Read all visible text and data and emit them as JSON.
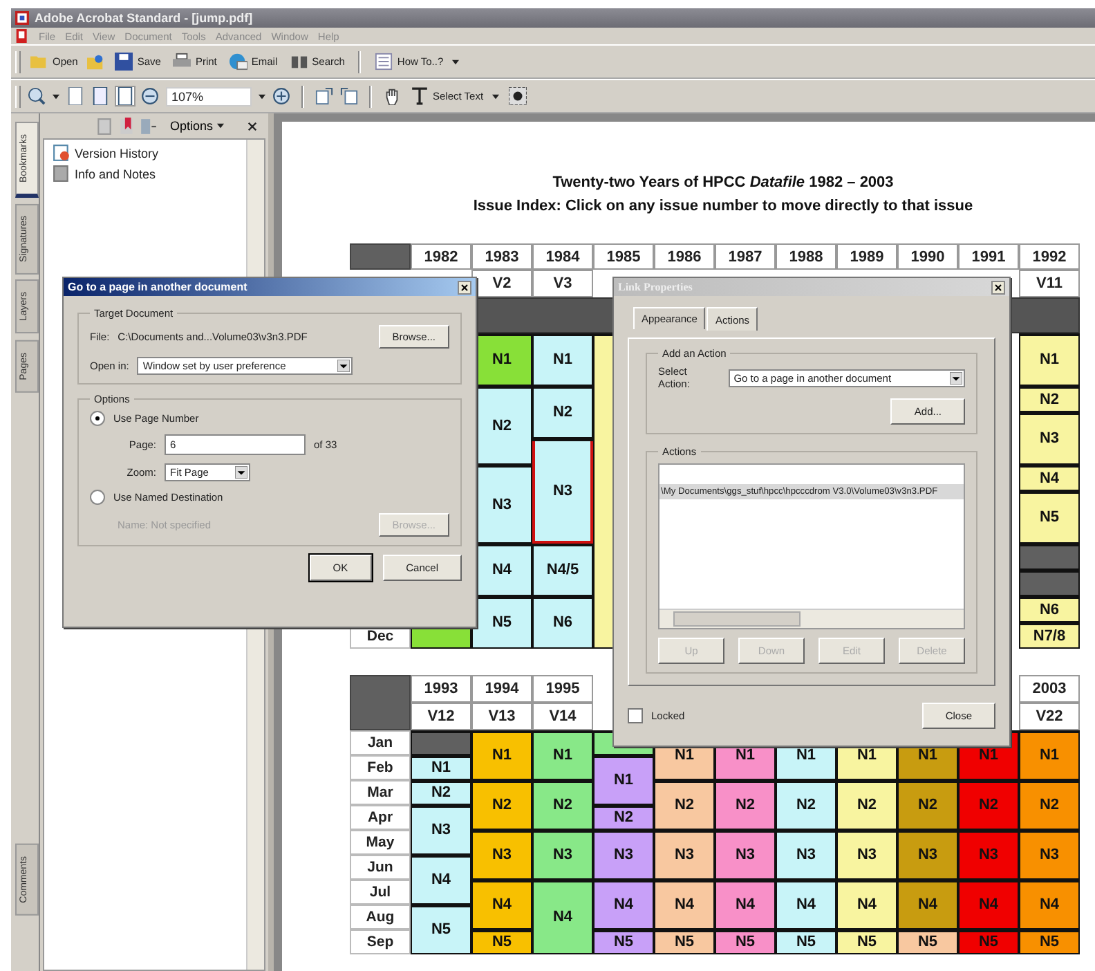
{
  "window": {
    "title": "Adobe Acrobat Standard - [jump.pdf]"
  },
  "menu": [
    "File",
    "Edit",
    "View",
    "Document",
    "Tools",
    "Advanced",
    "Window",
    "Help"
  ],
  "toolbar": {
    "open": "Open",
    "save": "Save",
    "print": "Print",
    "email": "Email",
    "search": "Search",
    "how_to": "How To..?",
    "zoom": "107%",
    "select_text": "Select Text"
  },
  "side_tabs": [
    {
      "label": "Bookmarks",
      "selected": true
    },
    {
      "label": "Signatures",
      "selected": false
    },
    {
      "label": "Layers",
      "selected": false
    },
    {
      "label": "Pages",
      "selected": false
    }
  ],
  "comments_tab": {
    "label": "Comments",
    "selected": false
  },
  "bookmarks_panel": {
    "options": "Options",
    "items": [
      {
        "label": "Version History",
        "kind": "history"
      },
      {
        "label": "Info and Notes",
        "kind": "page"
      }
    ]
  },
  "document": {
    "title": "Twenty-two Years of HPCC *Datafile* 1982 – 2003",
    "subtitle": "Issue Index: Click on any issue number to move directly to that issue",
    "upper_table": {
      "last_row_label": "Dec",
      "columns": [
        {
          "year": "1982",
          "last_cell": {
            "color": "#88e038",
            "selected": false
          }
        },
        {
          "year": "1983",
          "volume": "V2",
          "cells": [
            {
              "text": "N1",
              "color": "#88e038",
              "selected": false
            },
            {
              "merged": true
            },
            {
              "text": "N2",
              "color": "#c8f4f8",
              "selected": false
            },
            {
              "merged": true
            },
            {
              "merged": true
            },
            {
              "text": "N3",
              "color": "#c8f4f8",
              "selected": false
            },
            {
              "merged": true
            },
            {
              "merged": true
            },
            {
              "text": "N4",
              "color": "#c8f4f8",
              "selected": false
            },
            {
              "merged": true
            },
            {
              "text": "N5",
              "color": "#c8f4f8",
              "selected": false
            },
            {
              "merged": true
            }
          ]
        },
        {
          "year": "1984",
          "volume": "V3",
          "cells": [
            {
              "text": "N1",
              "color": "#c8f4f8",
              "selected": false
            },
            {
              "merged": true
            },
            {
              "text": "N2",
              "color": "#c8f4f8",
              "selected": false
            },
            {
              "merged": true
            },
            {
              "text": "N3",
              "color": "#c8f4f8",
              "selected": true
            },
            {
              "merged": true
            },
            {
              "merged": true
            },
            {
              "merged": true
            },
            {
              "text": "N4/5",
              "color": "#c8f4f8",
              "selected": false
            },
            {
              "merged": true
            },
            {
              "text": "N6",
              "color": "#c8f4f8",
              "selected": false
            },
            {
              "merged": true
            }
          ]
        },
        {
          "year": "1985",
          "cells": [
            {
              "color": "#f8f4a0",
              "selected": false
            },
            {
              "merged": true
            },
            {
              "merged": true
            },
            {
              "merged": true
            },
            {
              "merged": true
            },
            {
              "merged": true
            },
            {
              "merged": true
            },
            {
              "merged": true
            },
            {
              "merged": true
            },
            {
              "merged": true
            },
            {
              "merged": true
            },
            {
              "merged": true
            }
          ]
        },
        {
          "year": "1986"
        },
        {
          "year": "1987"
        },
        {
          "year": "1988"
        },
        {
          "year": "1989"
        },
        {
          "year": "1990"
        },
        {
          "year": "1991"
        },
        {
          "year": "1992",
          "volume": "V11",
          "cells": [
            {
              "text": "N1",
              "color": "#f8f4a0",
              "selected": false
            },
            {
              "merged": true
            },
            {
              "text": "N2",
              "color": "#f8f4a0",
              "selected": false
            },
            {
              "text": "N3",
              "color": "#f8f4a0",
              "selected": false
            },
            {
              "merged": true
            },
            {
              "text": "N4",
              "color": "#f8f4a0",
              "selected": false
            },
            {
              "text": "N5",
              "color": "#f8f4a0",
              "selected": false
            },
            {
              "merged": true
            },
            {
              "color": "#606060",
              "selected": false
            },
            {
              "color": "#606060",
              "selected": false
            },
            {
              "text": "N6",
              "color": "#f8f4a0",
              "selected": false
            },
            {
              "text": "N7/8",
              "color": "#f8f4a0",
              "selected": false
            }
          ]
        }
      ]
    },
    "lower_table": {
      "month_labels": [
        "Jan",
        "Feb",
        "Mar",
        "Apr",
        "May",
        "Jun",
        "Jul",
        "Aug",
        "Sep"
      ],
      "columns": [
        {
          "year": "1993",
          "volume": "V12",
          "cells": [
            {
              "color": "#606060",
              "selected": false
            },
            {
              "text": "N1",
              "color": "#c8f4f8",
              "selected": false
            },
            {
              "text": "N2",
              "color": "#c8f4f8",
              "selected": false
            },
            {
              "text": "N3",
              "color": "#c8f4f8",
              "selected": false
            },
            {
              "merged": true
            },
            {
              "text": "N4",
              "color": "#c8f4f8",
              "selected": false
            },
            {
              "merged": true
            },
            {
              "text": "N5",
              "color": "#c8f4f8",
              "selected": false
            },
            {
              "merged": true
            }
          ]
        },
        {
          "year": "1994",
          "volume": "V13",
          "cells": [
            {
              "text": "N1",
              "color": "#f8c000",
              "selected": false
            },
            {
              "merged": true
            },
            {
              "text": "N2",
              "color": "#f8c000",
              "selected": false
            },
            {
              "merged": true
            },
            {
              "text": "N3",
              "color": "#f8c000",
              "selected": false
            },
            {
              "merged": true
            },
            {
              "text": "N4",
              "color": "#f8c000",
              "selected": false
            },
            {
              "merged": true
            },
            {
              "text": "N5",
              "color": "#f8c000",
              "selected": false
            }
          ]
        },
        {
          "year": "1995",
          "volume": "V14",
          "cells": [
            {
              "text": "N1",
              "color": "#88e888",
              "selected": false
            },
            {
              "merged": true
            },
            {
              "text": "N2",
              "color": "#88e888",
              "selected": false
            },
            {
              "merged": true
            },
            {
              "text": "N3",
              "color": "#88e888",
              "selected": false
            },
            {
              "merged": true
            },
            {
              "text": "N4",
              "color": "#88e888",
              "selected": false
            },
            {
              "merged": true
            },
            {
              "merged": true
            }
          ]
        },
        {
          "cells": [
            {
              "color": "#88e888",
              "selected": false
            },
            {
              "text": "N1",
              "color": "#c8a0f8",
              "selected": false
            },
            {
              "merged": true
            },
            {
              "text": "N2",
              "color": "#c8a0f8",
              "selected": false
            },
            {
              "text": "N3",
              "color": "#c8a0f8",
              "selected": false
            },
            {
              "merged": true
            },
            {
              "text": "N4",
              "color": "#c8a0f8",
              "selected": false
            },
            {
              "merged": true
            },
            {
              "text": "N5",
              "color": "#c8a0f8",
              "selected": false
            }
          ]
        },
        {
          "cells": [
            {
              "text": "N1",
              "color": "#f8c8a0",
              "selected": false
            },
            {
              "merged": true
            },
            {
              "text": "N2",
              "color": "#f8c8a0",
              "selected": false
            },
            {
              "merged": true
            },
            {
              "text": "N3",
              "color": "#f8c8a0",
              "selected": false
            },
            {
              "merged": true
            },
            {
              "text": "N4",
              "color": "#f8c8a0",
              "selected": false
            },
            {
              "merged": true
            },
            {
              "text": "N5",
              "color": "#f8c8a0",
              "selected": false
            }
          ]
        },
        {
          "cells": [
            {
              "text": "N1",
              "color": "#f890c8",
              "selected": false
            },
            {
              "merged": true
            },
            {
              "text": "N2",
              "color": "#f890c8",
              "selected": false
            },
            {
              "merged": true
            },
            {
              "text": "N3",
              "color": "#f890c8",
              "selected": false
            },
            {
              "merged": true
            },
            {
              "text": "N4",
              "color": "#f890c8",
              "selected": false
            },
            {
              "merged": true
            },
            {
              "text": "N5",
              "color": "#f890c8",
              "selected": false
            }
          ]
        },
        {
          "cells": [
            {
              "text": "N1",
              "color": "#c8f4f8",
              "selected": false
            },
            {
              "merged": true
            },
            {
              "text": "N2",
              "color": "#c8f4f8",
              "selected": false
            },
            {
              "merged": true
            },
            {
              "text": "N3",
              "color": "#c8f4f8",
              "selected": false
            },
            {
              "merged": true
            },
            {
              "text": "N4",
              "color": "#c8f4f8",
              "selected": false
            },
            {
              "merged": true
            },
            {
              "text": "N5",
              "color": "#c8f4f8",
              "selected": false
            }
          ]
        },
        {
          "cells": [
            {
              "text": "N1",
              "color": "#f8f4a0",
              "selected": false
            },
            {
              "merged": true
            },
            {
              "text": "N2",
              "color": "#f8f4a0",
              "selected": false
            },
            {
              "merged": true
            },
            {
              "text": "N3",
              "color": "#f8f4a0",
              "selected": false
            },
            {
              "merged": true
            },
            {
              "text": "N4",
              "color": "#f8f4a0",
              "selected": false
            },
            {
              "merged": true
            },
            {
              "text": "N5",
              "color": "#f8f4a0",
              "selected": false
            }
          ]
        },
        {
          "cells": [
            {
              "text": "N1",
              "color": "#c89c10",
              "selected": false
            },
            {
              "merged": true
            },
            {
              "text": "N2",
              "color": "#c89c10",
              "selected": false
            },
            {
              "merged": true
            },
            {
              "text": "N3",
              "color": "#c89c10",
              "selected": false
            },
            {
              "merged": true
            },
            {
              "text": "N4",
              "color": "#c89c10",
              "selected": false
            },
            {
              "merged": true
            },
            {
              "text": "N5",
              "color": "#f8c8a0",
              "selected": false
            }
          ]
        },
        {
          "cells": [
            {
              "text": "N1",
              "color": "#f00000",
              "selected": false
            },
            {
              "merged": true
            },
            {
              "text": "N2",
              "color": "#f00000",
              "selected": false
            },
            {
              "merged": true
            },
            {
              "text": "N3",
              "color": "#f00000",
              "selected": false
            },
            {
              "merged": true
            },
            {
              "text": "N4",
              "color": "#f00000",
              "selected": false
            },
            {
              "merged": true
            },
            {
              "text": "N5",
              "color": "#f00000",
              "selected": false
            }
          ]
        },
        {
          "year": "2003",
          "volume": "V22",
          "cells": [
            {
              "text": "N1",
              "color": "#f89000",
              "selected": false
            },
            {
              "merged": true
            },
            {
              "text": "N2",
              "color": "#f89000",
              "selected": false
            },
            {
              "merged": true
            },
            {
              "text": "N3",
              "color": "#f89000",
              "selected": false
            },
            {
              "merged": true
            },
            {
              "text": "N4",
              "color": "#f89000",
              "selected": false
            },
            {
              "merged": true
            },
            {
              "text": "N5",
              "color": "#f89000",
              "selected": false
            }
          ]
        }
      ]
    }
  },
  "go_to_page_dialog": {
    "title": "Go to a page in another document",
    "active": true,
    "target_group": "Target Document",
    "file_label": "File:",
    "file_value": "C:\\Documents and...Volume03\\v3n3.PDF",
    "browse": {
      "label": "Browse...",
      "disabled": false
    },
    "open_in_label": "Open in:",
    "open_in_value": "Window set by user preference",
    "options_group": "Options",
    "radios": [
      {
        "label": "Use Page Number",
        "selected": true
      },
      {
        "label": "Use Named Destination",
        "selected": false
      }
    ],
    "page_label": "Page:",
    "page_value": "6",
    "page_of": "of 33",
    "zoom_label": "Zoom:",
    "zoom_value": "Fit Page",
    "name_label": "Name:",
    "name_value": "Not specified",
    "name_disabled": true,
    "browse_2": {
      "label": "Browse...",
      "disabled": true
    },
    "buttons": [
      {
        "label": "OK",
        "default": true
      },
      {
        "label": "Cancel",
        "default": false
      }
    ]
  },
  "link_properties_dialog": {
    "title": "Link Properties",
    "active": false,
    "tabs": [
      {
        "label": "Appearance",
        "selected": false
      },
      {
        "label": "Actions",
        "selected": true
      }
    ],
    "add_group": "Add an Action",
    "select_label": "Select Action:",
    "select_value": "Go to a page in another document",
    "add_button": "Add...",
    "actions_group": "Actions",
    "actions": [
      {
        "label": "\\My Documents\\ggs_stuf\\hpcc\\hpcccdrom V3.0\\Volume03\\v3n3.PDF",
        "selected": true
      }
    ],
    "action_buttons": [
      {
        "label": "Up",
        "disabled": true
      },
      {
        "label": "Down",
        "disabled": true
      },
      {
        "label": "Edit",
        "disabled": true
      },
      {
        "label": "Delete",
        "disabled": true
      }
    ],
    "locked": {
      "label": "Locked",
      "checked": false
    },
    "close_button": "Close"
  }
}
